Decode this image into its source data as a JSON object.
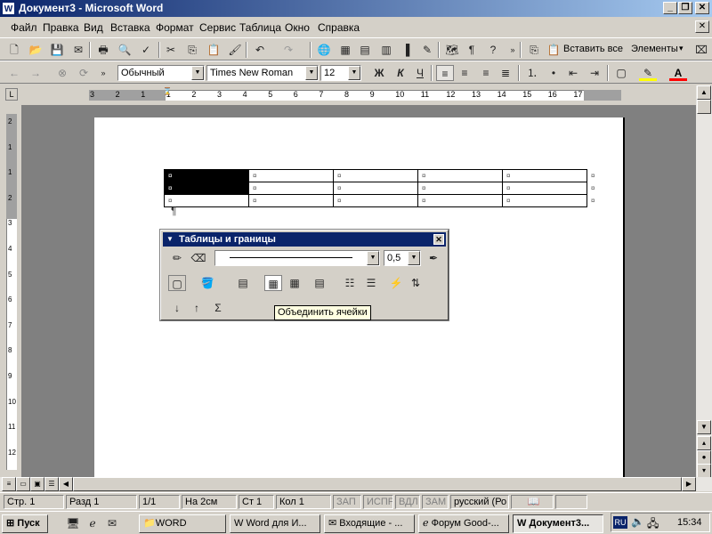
{
  "window": {
    "title": "Документ3 - Microsoft Word",
    "app_icon": "W"
  },
  "menubar": [
    "Файл",
    "Правка",
    "Вид",
    "Вставка",
    "Формат",
    "Сервис",
    "Таблица",
    "Окно",
    "Справка"
  ],
  "toolbar1": {
    "paste_all_label": "Вставить все",
    "elements_label": "Элементы"
  },
  "toolbar2": {
    "style_value": "Обычный",
    "font_value": "Times New Roman",
    "size_value": "12",
    "bold": "Ж",
    "italic": "К",
    "underline": "Ч"
  },
  "ruler_numbers": [
    "3",
    "2",
    "1",
    "1",
    "2",
    "3",
    "4",
    "5",
    "6",
    "7",
    "8",
    "9",
    "10",
    "11",
    "12",
    "13",
    "14",
    "15",
    "16",
    "17"
  ],
  "vruler_numbers": [
    "2",
    "1",
    "1",
    "2",
    "3",
    "4",
    "5",
    "6",
    "7",
    "8",
    "9",
    "10",
    "11",
    "12"
  ],
  "document": {
    "rows": [
      [
        "¤",
        "¤",
        "¤",
        "¤",
        "¤",
        "¤"
      ],
      [
        "¤",
        "¤",
        "¤",
        "¤",
        "¤",
        "¤"
      ],
      [
        "¤",
        "¤",
        "¤",
        "¤",
        "¤",
        "¤"
      ]
    ],
    "pilcrow": "¶"
  },
  "tables_toolbar": {
    "title": "Таблицы и границы",
    "line_weight": "0,5",
    "sum_symbol": "Σ"
  },
  "tooltip": "Объединить ячейки",
  "statusbar": {
    "page": "Стр. 1",
    "section": "Разд 1",
    "pages": "1/1",
    "at": "На 2см",
    "line": "Ст 1",
    "col": "Кол 1",
    "rec": "ЗАП",
    "trk": "ИСПР",
    "ext": "ВДЛ",
    "ovr": "ЗАМ",
    "lang": "русский (Ро"
  },
  "taskbar": {
    "start": "Пуск",
    "tasks": [
      "WORD",
      "Word для И...",
      "Входящие - ...",
      "Форум Good-...",
      "Документ3..."
    ],
    "lang": "RU",
    "clock": "15:34"
  },
  "colors": {
    "titlebar": "#0a246a",
    "highlight": "#ffff00",
    "font_color": "#ff0000"
  }
}
